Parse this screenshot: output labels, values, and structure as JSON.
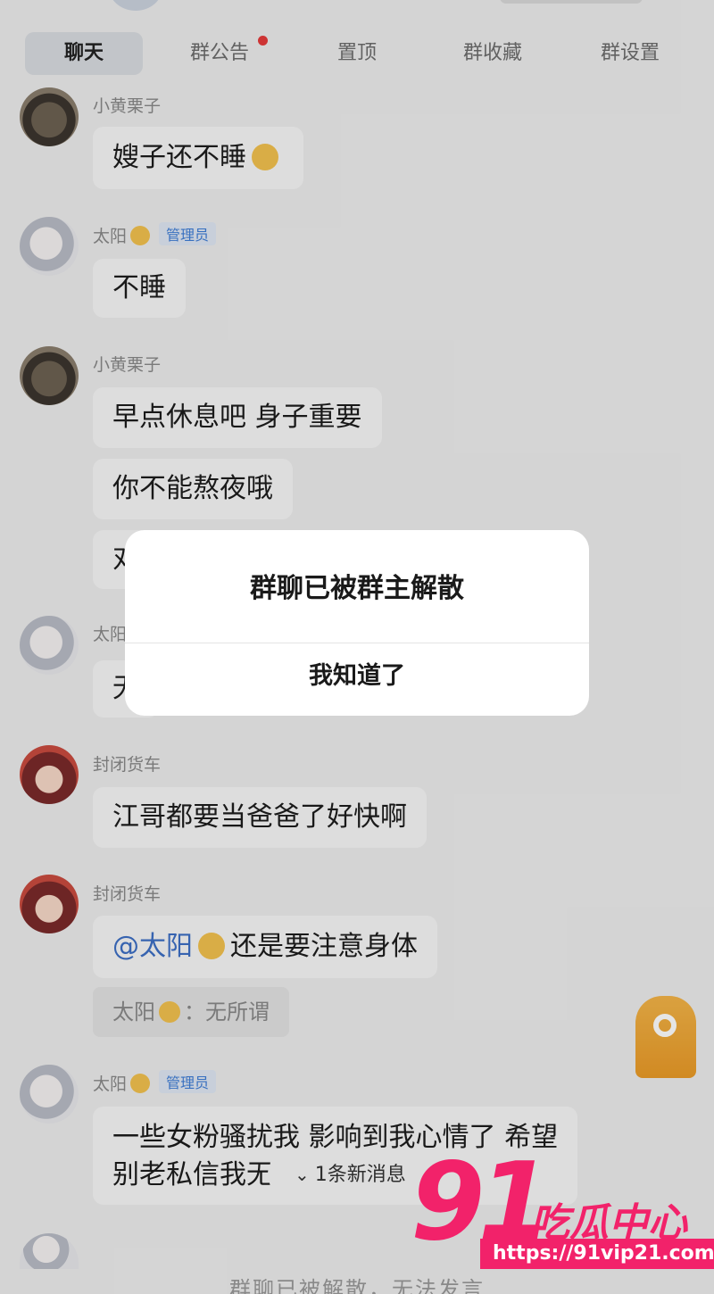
{
  "tabs": {
    "chat": "聊天",
    "announcement": "群公告",
    "pinned": "置顶",
    "favorites": "群收藏",
    "settings": "群设置"
  },
  "messages": [
    {
      "sender": "小黄栗子",
      "text": "嫂子还不睡"
    },
    {
      "sender": "太阳",
      "badge": "管理员",
      "text": "不睡"
    },
    {
      "sender": "小黄栗子",
      "text1": "早点休息吧 身子重要",
      "text2": "你不能熬夜哦",
      "text3": "对"
    },
    {
      "sender": "太阳",
      "text": "无"
    },
    {
      "sender": "封闭货车",
      "text": "江哥都要当爸爸了好快啊"
    },
    {
      "sender": "封闭货车",
      "mention": "@太阳",
      "text": "还是要注意身体",
      "quote_sender": "太阳",
      "quote_text": "：无所谓"
    },
    {
      "sender": "太阳",
      "badge": "管理员",
      "line1": "一些女粉骚扰我 影响到我心情了 希望",
      "line2": "别老私信我无"
    }
  ],
  "dialog": {
    "title": "群聊已被群主解散",
    "button": "我知道了"
  },
  "new_messages": "1条新消息",
  "bottom_notice": "群聊已被解散，无法发言",
  "watermark": {
    "number": "91",
    "brand": "吃瓜中心",
    "url": "https://91vip21.com"
  },
  "icons": {
    "new_messages": "chevron-down-icon",
    "floating": "app-ring-icon",
    "sender_emoji": "sun-face-emoji"
  },
  "colors": {
    "accent_red": "#e53a3a",
    "mention_blue": "#3d6fc4",
    "watermark_pink": "#f2226a"
  }
}
